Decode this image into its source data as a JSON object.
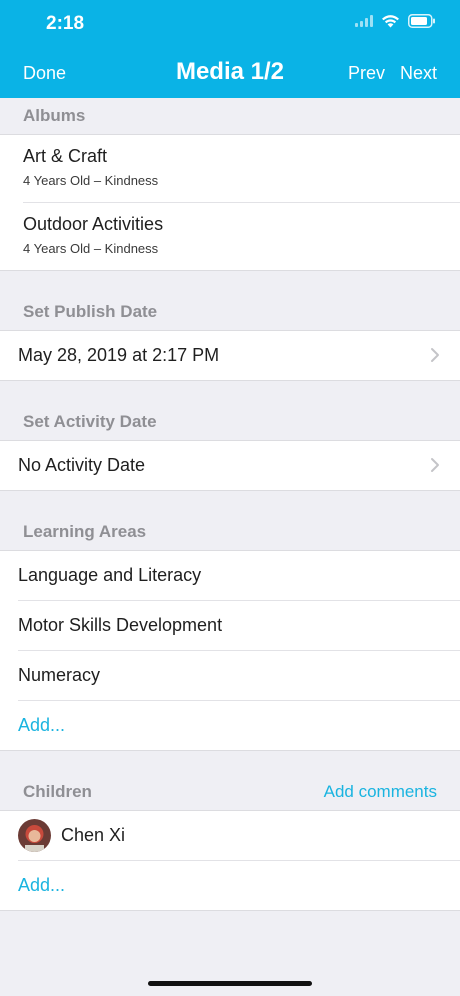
{
  "status_bar": {
    "time": "2:18"
  },
  "nav": {
    "done": "Done",
    "title": "Media 1/2",
    "prev": "Prev",
    "next": "Next"
  },
  "albums": {
    "header": "Albums",
    "items": [
      {
        "title": "Art & Craft",
        "subtitle": "4 Years Old – Kindness"
      },
      {
        "title": "Outdoor Activities",
        "subtitle": "4 Years Old – Kindness"
      }
    ]
  },
  "publish_date": {
    "header": "Set Publish Date",
    "value": "May 28, 2019 at 2:17 PM"
  },
  "activity_date": {
    "header": "Set Activity Date",
    "value": "No Activity Date"
  },
  "learning_areas": {
    "header": "Learning Areas",
    "items": [
      "Language and Literacy",
      "Motor Skills Development",
      "Numeracy"
    ],
    "add": "Add..."
  },
  "children": {
    "header": "Children",
    "add_comments": "Add comments",
    "items": [
      {
        "name": "Chen Xi"
      }
    ],
    "add": "Add..."
  },
  "colors": {
    "accent": "#0ab3e6",
    "link": "#1ab4e0",
    "background": "#efeff4"
  }
}
